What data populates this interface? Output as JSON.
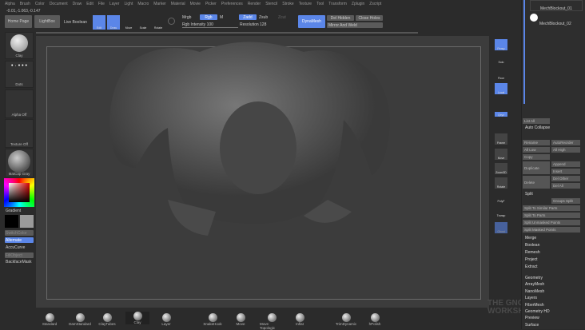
{
  "menu": [
    "Alpha",
    "Brush",
    "Color",
    "Document",
    "Draw",
    "Edit",
    "File",
    "Layer",
    "Light",
    "Macro",
    "Marker",
    "Material",
    "Movie",
    "Picker",
    "Preferences",
    "Render",
    "Stencil",
    "Stroke",
    "Texture",
    "Tool",
    "Transform",
    "Zplugin",
    "Zscript"
  ],
  "coords": "-0.01,-1.063,-0.147",
  "toolbar": {
    "home": "Home Page",
    "lightbox": "LightBox",
    "live_boolean": "Live Boolean",
    "edit": "Edit",
    "draw": "Draw",
    "move": "Move",
    "scale": "Scale",
    "rotate": "Rotate",
    "mrgb": "Mrgb",
    "rgb": "Rgb",
    "m": "M",
    "zadd": "Zadd",
    "zsub": "Zsub",
    "zcut": "Zcut",
    "rgb_intensity": "Rgb Intensity 100",
    "resolution": "Resolution 128",
    "dynamesh": "DynaMesh",
    "del_hidden": "Del Hidden",
    "close_holes": "Close Holes",
    "mirror_weld": "Mirror And Weld"
  },
  "left": {
    "brush": "Clay",
    "stroke": "Dots",
    "alpha": "Alpha Off",
    "texture": "Texture Off",
    "material": "MatCap Gray",
    "gradient": "Gradient",
    "switch_color": "SwitchColor",
    "alternate": "Alternate",
    "accucurve": "AccuCurve",
    "fill_object": "FillObject",
    "backface": "BackfaceMask"
  },
  "shelf": {
    "persp": "Persp",
    "dynamic": "Dynamic",
    "solo": "Solo",
    "floor": "Floor",
    "local": "Local",
    "xyz": "Qxyz",
    "frame": "Frame",
    "move": "Move",
    "zoom3d": "Zoom3D",
    "rotate": "Rotate",
    "linefill": "Line Fill",
    "polyf": "PolyF",
    "transp": "Transp",
    "ghost": "Ghost"
  },
  "subtools": [
    {
      "name": "MechBlockout_01"
    },
    {
      "name": "MechBlockout_02"
    }
  ],
  "panel": {
    "list_all": "List All",
    "auto_collapse": "Auto Collapse",
    "rename": "Rename",
    "autoreorder": "AutoReorder",
    "all_low": "All Low",
    "all_high": "All High",
    "copy": "Copy",
    "duplicate": "Duplicate",
    "append": "Append",
    "insert": "Insert",
    "delete": "Delete",
    "del_other": "Del Other",
    "del_all": "Del All",
    "split": "Split",
    "groups_split": "Groups Split",
    "split_similar": "Split To Similar Parts",
    "split_parts": "Split To Parts",
    "split_unmasked": "Split Unmasked Points",
    "split_masked": "Split Masked Points",
    "merge": "Merge",
    "boolean": "Boolean",
    "remesh": "Remesh",
    "project": "Project",
    "extract": "Extract"
  },
  "sections": [
    "Geometry",
    "ArrayMesh",
    "NanoMesh",
    "Layers",
    "FiberMesh",
    "Geometry HD",
    "Preview",
    "Surface"
  ],
  "brushes": [
    "Standard",
    "DamStandard",
    "ClayTubes",
    "Clay",
    "Layer",
    "SnakeHook",
    "Move",
    "Move Topologic",
    "Inflat",
    "TrimDynamic",
    "hPolish"
  ],
  "watermark": "THE GNOMON WORKSHOP"
}
